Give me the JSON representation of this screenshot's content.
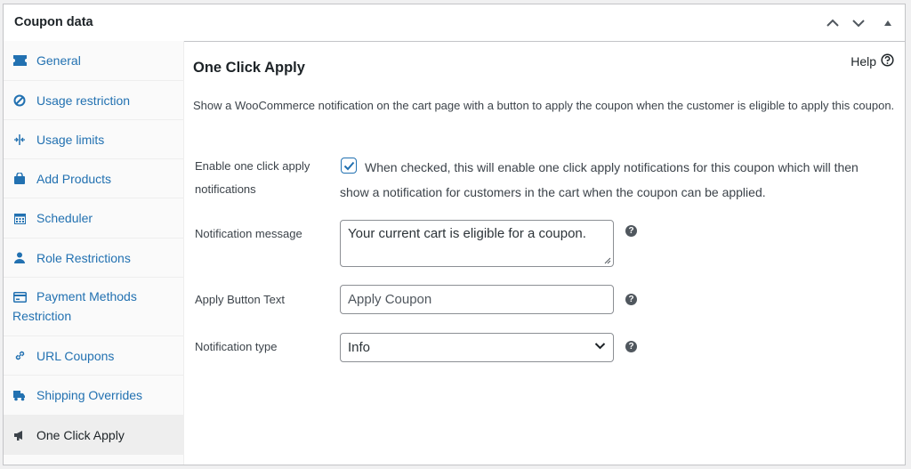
{
  "panel": {
    "title": "Coupon data"
  },
  "sidebar": {
    "items": [
      {
        "label": "General",
        "icon": "ticket-icon"
      },
      {
        "label": "Usage restriction",
        "icon": "block-icon"
      },
      {
        "label": "Usage limits",
        "icon": "limit-icon"
      },
      {
        "label": "Add Products",
        "icon": "bag-icon"
      },
      {
        "label": "Scheduler",
        "icon": "calendar-icon"
      },
      {
        "label": "Role Restrictions",
        "icon": "user-icon"
      },
      {
        "label": "Payment Methods Restriction",
        "icon": "card-icon"
      },
      {
        "label": "URL Coupons",
        "icon": "link-icon"
      },
      {
        "label": "Shipping Overrides",
        "icon": "truck-icon"
      },
      {
        "label": "One Click Apply",
        "icon": "megaphone-icon",
        "active": true
      }
    ]
  },
  "content": {
    "title": "One Click Apply",
    "help_label": "Help",
    "description": "Show a WooCommerce notification on the cart page with a button to apply the coupon when the customer is eligible to apply this coupon.",
    "enable": {
      "label": "Enable one click apply notifications",
      "checked": true,
      "text": "When checked, this will enable one click apply notifications for this coupon which will then show a notification for customers in the cart when the coupon can be applied."
    },
    "message": {
      "label": "Notification message",
      "value": "Your current cart is eligible for a coupon."
    },
    "button_text": {
      "label": "Apply Button Text",
      "value": "Apply Coupon"
    },
    "type": {
      "label": "Notification type",
      "value": "Info"
    }
  },
  "colors": {
    "link": "#2271b1",
    "text": "#1d2327",
    "border": "#8c8f94"
  }
}
